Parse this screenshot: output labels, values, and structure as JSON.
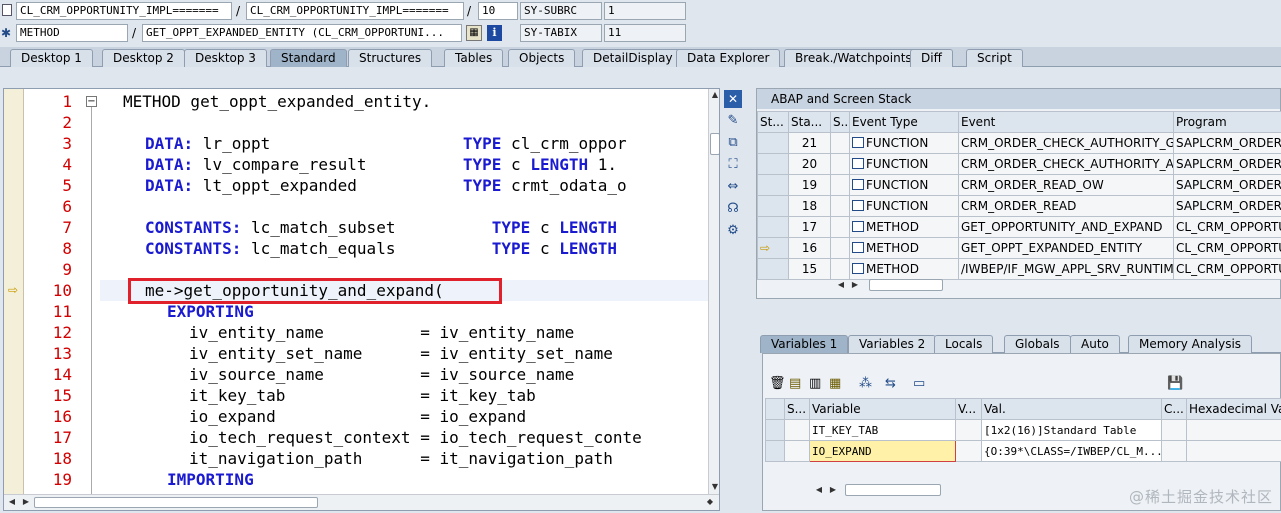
{
  "top": {
    "row1": {
      "field1": "CL_CRM_OPPORTUNITY_IMPL=======",
      "field2": "CL_CRM_OPPORTUNITY_IMPL=======",
      "field3": "10",
      "sysvar": "SY-SUBRC",
      "sysval": "1"
    },
    "row2": {
      "field1": "METHOD",
      "field2": "GET_OPPT_EXPANDED_ENTITY (CL_CRM_OPPORTUNI...",
      "sysvar": "SY-TABIX",
      "sysval": "11"
    },
    "sep": "/"
  },
  "tabs": [
    "Desktop 1",
    "Desktop 2",
    "Desktop 3",
    "Standard",
    "Structures",
    "Tables",
    "Objects",
    "DetailDisplay",
    "Data Explorer",
    "Break./Watchpoints",
    "Diff",
    "Script"
  ],
  "active_tab": "Standard",
  "code": {
    "line_numbers": [
      "1",
      "2",
      "3",
      "4",
      "5",
      "6",
      "7",
      "8",
      "9",
      "10",
      "11",
      "12",
      "13",
      "14",
      "15",
      "16",
      "17",
      "18",
      "19"
    ],
    "lines": [
      {
        "n": "1",
        "parts": [
          {
            "t": "METHOD get_oppt_expanded_entity.",
            "k": false
          }
        ],
        "indent": 0
      },
      {
        "n": "2",
        "parts": [],
        "indent": 0
      },
      {
        "n": "3",
        "parts": [
          {
            "t": "DATA:",
            "k": true
          },
          {
            "t": " lr_oppt                    ",
            "k": false
          },
          {
            "t": "TYPE",
            "k": true
          },
          {
            "t": " cl_crm_oppor",
            "k": false
          }
        ],
        "indent": 2
      },
      {
        "n": "4",
        "parts": [
          {
            "t": "DATA:",
            "k": true
          },
          {
            "t": " lv_compare_result          ",
            "k": false
          },
          {
            "t": "TYPE",
            "k": true
          },
          {
            "t": " c ",
            "k": false
          },
          {
            "t": "LENGTH",
            "k": true
          },
          {
            "t": " 1.",
            "k": false
          }
        ],
        "indent": 2
      },
      {
        "n": "5",
        "parts": [
          {
            "t": "DATA:",
            "k": true
          },
          {
            "t": " lt_oppt_expanded           ",
            "k": false
          },
          {
            "t": "TYPE",
            "k": true
          },
          {
            "t": " crmt_odata_o",
            "k": false
          }
        ],
        "indent": 2
      },
      {
        "n": "6",
        "parts": [],
        "indent": 0
      },
      {
        "n": "7",
        "parts": [
          {
            "t": "CONSTANTS:",
            "k": true
          },
          {
            "t": " lc_match_subset          ",
            "k": false
          },
          {
            "t": "TYPE",
            "k": true
          },
          {
            "t": " c ",
            "k": false
          },
          {
            "t": "LENGTH",
            "k": true
          }
        ],
        "indent": 2
      },
      {
        "n": "8",
        "parts": [
          {
            "t": "CONSTANTS:",
            "k": true
          },
          {
            "t": " lc_match_equals          ",
            "k": false
          },
          {
            "t": "TYPE",
            "k": true
          },
          {
            "t": " c ",
            "k": false
          },
          {
            "t": "LENGTH",
            "k": true
          }
        ],
        "indent": 2
      },
      {
        "n": "9",
        "parts": [],
        "indent": 0
      },
      {
        "n": "10",
        "parts": [
          {
            "t": "me->get_opportunity_and_expand(",
            "k": false
          }
        ],
        "indent": 2
      },
      {
        "n": "11",
        "parts": [
          {
            "t": "EXPORTING",
            "k": true
          }
        ],
        "indent": 4
      },
      {
        "n": "12",
        "parts": [
          {
            "t": "iv_entity_name          = iv_entity_name",
            "k": false
          }
        ],
        "indent": 6
      },
      {
        "n": "13",
        "parts": [
          {
            "t": "iv_entity_set_name      = iv_entity_set_name",
            "k": false
          }
        ],
        "indent": 6
      },
      {
        "n": "14",
        "parts": [
          {
            "t": "iv_source_name          = iv_source_name",
            "k": false
          }
        ],
        "indent": 6
      },
      {
        "n": "15",
        "parts": [
          {
            "t": "it_key_tab              = it_key_tab",
            "k": false
          }
        ],
        "indent": 6
      },
      {
        "n": "16",
        "parts": [
          {
            "t": "io_expand               = io_expand",
            "k": false
          }
        ],
        "indent": 6
      },
      {
        "n": "17",
        "parts": [
          {
            "t": "io_tech_request_context = io_tech_request_conte",
            "k": false
          }
        ],
        "indent": 6
      },
      {
        "n": "18",
        "parts": [
          {
            "t": "it_navigation_path      = it_navigation_path",
            "k": false
          }
        ],
        "indent": 6
      },
      {
        "n": "19",
        "parts": [
          {
            "t": "IMPORTING",
            "k": true
          }
        ],
        "indent": 4
      }
    ]
  },
  "stack": {
    "title": "ABAP and Screen Stack",
    "columns": [
      "St...",
      "Sta...",
      "S...",
      "Event Type",
      "Event",
      "Program"
    ],
    "rows": [
      {
        "sta": "21",
        "type": "FUNCTION",
        "event": "CRM_ORDER_CHECK_AUTHORITY_GE...",
        "program": "SAPLCRM_ORDER_C"
      },
      {
        "sta": "20",
        "type": "FUNCTION",
        "event": "CRM_ORDER_CHECK_AUTHORITY_AC...",
        "program": "SAPLCRM_ORDER_C"
      },
      {
        "sta": "19",
        "type": "FUNCTION",
        "event": "CRM_ORDER_READ_OW",
        "program": "SAPLCRM_ORDER_O"
      },
      {
        "sta": "18",
        "type": "FUNCTION",
        "event": "CRM_ORDER_READ",
        "program": "SAPLCRM_ORDER_A"
      },
      {
        "sta": "17",
        "type": "METHOD",
        "event": "GET_OPPORTUNITY_AND_EXPAND",
        "program": "CL_CRM_OPPORTU"
      },
      {
        "sta": "16",
        "type": "METHOD",
        "event": "GET_OPPT_EXPANDED_ENTITY",
        "program": "CL_CRM_OPPORTU"
      },
      {
        "sta": "15",
        "type": "METHOD",
        "event": "/IWBEP/IF_MGW_APPL_SRV_RUNTIM...",
        "program": "CL_CRM_OPPORTU"
      }
    ]
  },
  "vars": {
    "tabs": [
      "Variables 1",
      "Variables 2",
      "Locals",
      "Globals",
      "Auto",
      "Memory Analysis"
    ],
    "active_tab": "Variables 1",
    "columns": [
      "S...",
      "Variable",
      "V...",
      "Val.",
      "C...",
      "Hexadecimal Value"
    ],
    "rows": [
      {
        "variable": "IT_KEY_TAB",
        "value": "[1x2(16)]Standard Table"
      },
      {
        "variable": "IO_EXPAND",
        "value": "{O:39*\\CLASS=/IWBEP/CL_M..."
      }
    ]
  },
  "watermark": "@稀土掘金技术社区",
  "colors": {
    "keyword": "#1a1ad0",
    "line_number": "#d20000",
    "highlight_box": "#e0202a",
    "accent": "#9fb4c9"
  }
}
